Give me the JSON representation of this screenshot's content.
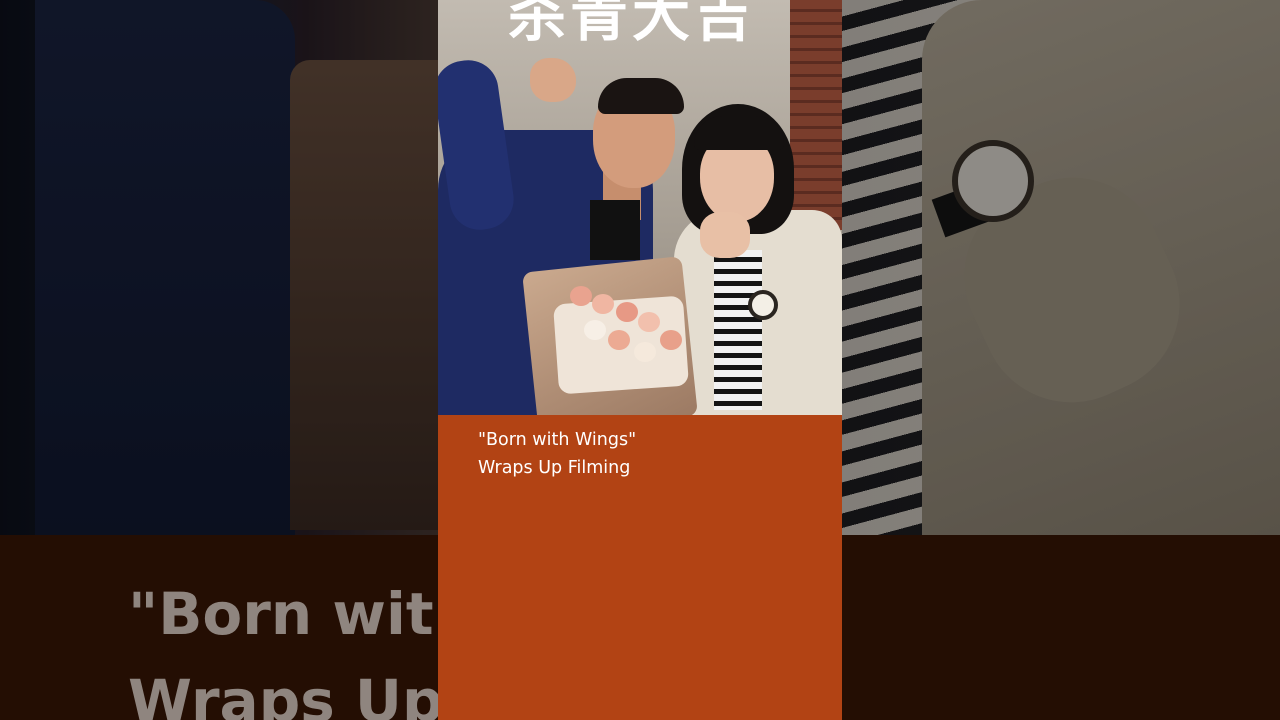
{
  "background": {
    "ghost_line_1": "\"Born with",
    "ghost_line_2": "Wraps Up"
  },
  "photo": {
    "calligraphy_text": "杀青大吉"
  },
  "caption": {
    "line_1": "\"Born with Wings\"",
    "line_2": "Wraps Up Filming"
  },
  "colors": {
    "card_bg": "#b24314",
    "band_bg": "#3a1705"
  }
}
